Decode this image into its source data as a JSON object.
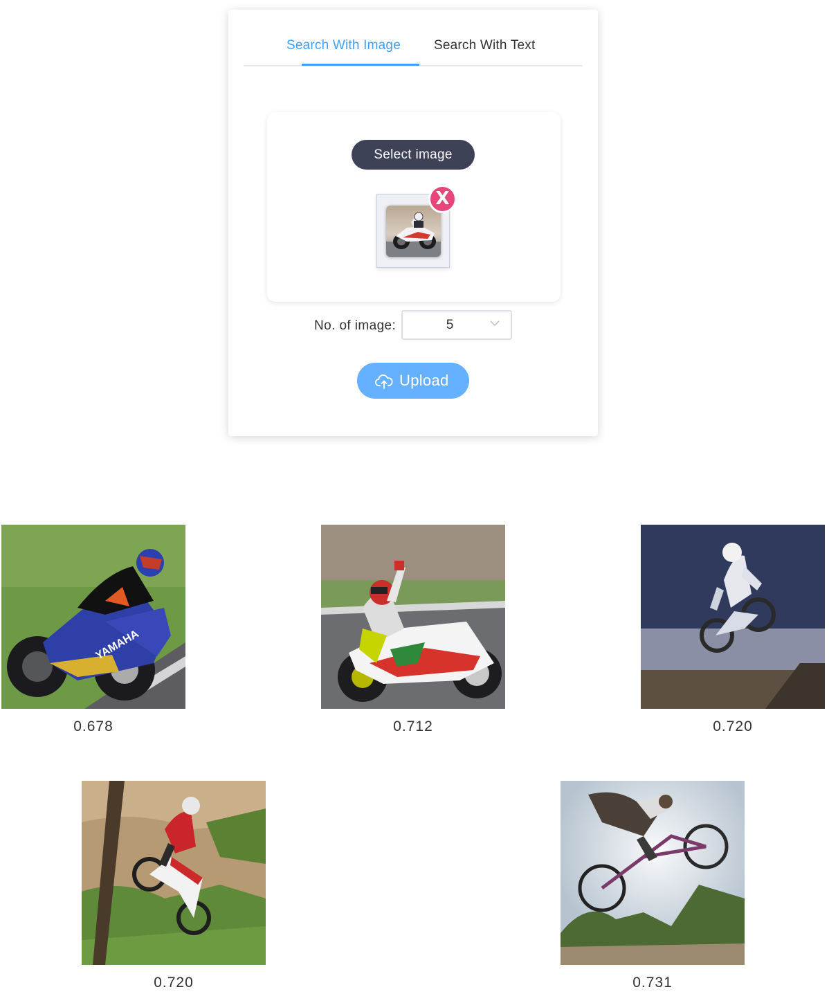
{
  "tabs": [
    {
      "label": "Search With Image",
      "active": true
    },
    {
      "label": "Search With Text",
      "active": false
    }
  ],
  "uploader": {
    "select_label": "Select image",
    "remove_label": "X",
    "preview_icon": "motorcycle-thumbnail"
  },
  "count": {
    "label": "No. of image:",
    "value": "5"
  },
  "upload": {
    "label": "Upload",
    "icon": "cloud-upload-icon"
  },
  "results": [
    {
      "score": "0.678",
      "image": "blue-yamaha-racing-motorcycle"
    },
    {
      "score": "0.712",
      "image": "white-red-racing-motorcycle-rider-waving"
    },
    {
      "score": "0.720",
      "image": "motocross-rider-jump-stadium"
    },
    {
      "score": "0.720",
      "image": "dirt-bike-jump-hillside"
    },
    {
      "score": "0.731",
      "image": "bmx-rider-jump-sun"
    }
  ],
  "colors": {
    "accent": "#409eff",
    "upload_button": "#66b1ff",
    "select_button": "#3e4256",
    "remove_button": "#e8467a"
  }
}
